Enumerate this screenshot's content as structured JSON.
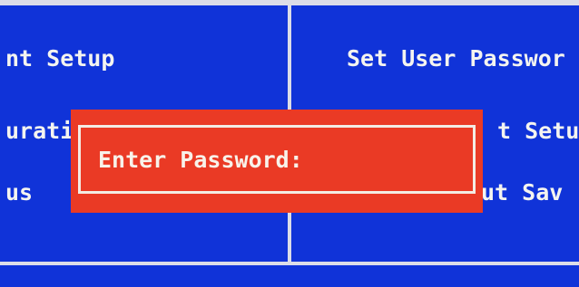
{
  "bios_menu": {
    "left_items": [
      "nt Setup",
      "urati",
      "us"
    ],
    "right_items": [
      "Set User Passwor",
      "t Setu",
      "ut Sav"
    ]
  },
  "password_dialog": {
    "prompt": "Enter Password:"
  },
  "colors": {
    "background": "#1033d8",
    "dialog": "#ea3a25",
    "text": "#f4f4f0",
    "lines": "#dcdde8"
  }
}
